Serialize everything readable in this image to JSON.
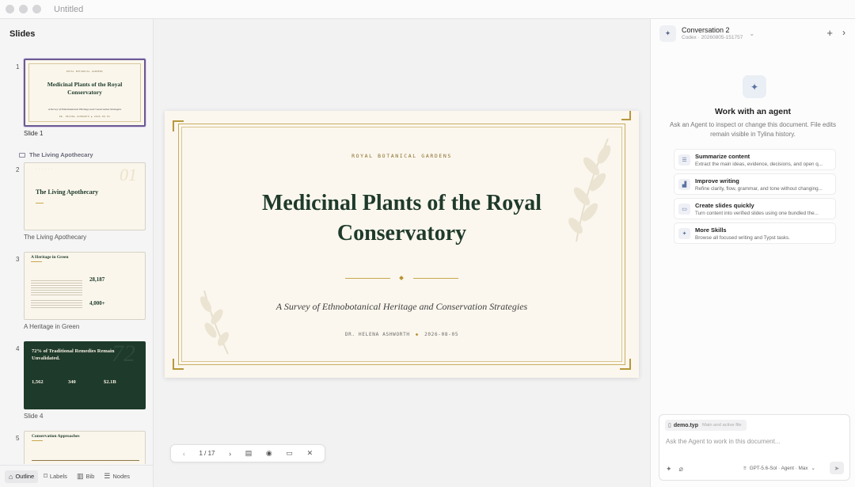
{
  "window": {
    "title": "Untitled"
  },
  "sidebar": {
    "title": "Slides",
    "section_label": "The Living Apothecary",
    "slides": [
      {
        "num": "1",
        "label": "Slide 1"
      },
      {
        "num": "2",
        "label": "The Living Apothecary"
      },
      {
        "num": "3",
        "label": "A Heritage in Green"
      },
      {
        "num": "4",
        "label": "Slide 4"
      },
      {
        "num": "5",
        "label": ""
      }
    ],
    "thumbs": {
      "t1_kicker": "ROYAL BOTANICAL GARDENS",
      "t1_title": "Medicinal Plants of the Royal Conservatory",
      "t1_sub": "A Survey of Ethnobotanical Heritage and Conservation Strategies",
      "t1_meta": "DR. HELENA ASHWORTH  ◆  2026-08-05",
      "t2_title": "The Living Apothecary",
      "t2_num": "01",
      "t3_title": "A Heritage in Green",
      "t3_stat1": "28,187",
      "t3_stat2": "4,000+",
      "t4_title": "72% of Traditional Remedies Remain Unvalidated.",
      "t4_bg_num": "72",
      "t4_v1": "1,562",
      "t4_v2": "340",
      "t4_v3": "$2.1B",
      "t5_title": "Conservation Approaches"
    },
    "tabs": [
      {
        "label": "Outline",
        "icon": "outline-icon"
      },
      {
        "label": "Labels",
        "icon": "tag-icon"
      },
      {
        "label": "Bib",
        "icon": "book-icon"
      },
      {
        "label": "Nodes",
        "icon": "list-icon"
      }
    ]
  },
  "slide": {
    "kicker": "ROYAL BOTANICAL GARDENS",
    "title": "Medicinal Plants of the Royal Conservatory",
    "subtitle": "A Survey of Ethnobotanical Heritage and Conservation Strategies",
    "author": "DR. HELENA ASHWORTH",
    "date": "2026-08-05",
    "accent": "#b8922d",
    "title_color": "#1f3a2b"
  },
  "toolbar": {
    "page": "1 / 17"
  },
  "agent_panel": {
    "conversation_title": "Conversation 2",
    "conversation_sub": "Codex · 20260805-151757",
    "heading": "Work with an agent",
    "description": "Ask an Agent to inspect or change this document. File edits remain visible in Tylina history.",
    "skills": [
      {
        "title": "Summarize content",
        "desc": "Extract the main ideas, evidence, decisions, and open q...",
        "icon": "list-icon"
      },
      {
        "title": "Improve writing",
        "desc": "Refine clarity, flow, grammar, and tone without changing...",
        "icon": "chart-icon"
      },
      {
        "title": "Create slides quickly",
        "desc": "Turn content into verified slides using one bundled the...",
        "icon": "presentation-icon"
      },
      {
        "title": "More Skills",
        "desc": "Browse all focused writing and Typst tasks.",
        "icon": "sparkle-icon"
      }
    ],
    "composer": {
      "file_name": "demo.typ",
      "file_note": "Main and active file",
      "placeholder": "Ask the Agent to work in this document...",
      "model": "GPT-5.6-Sol · Agent · Max"
    }
  }
}
